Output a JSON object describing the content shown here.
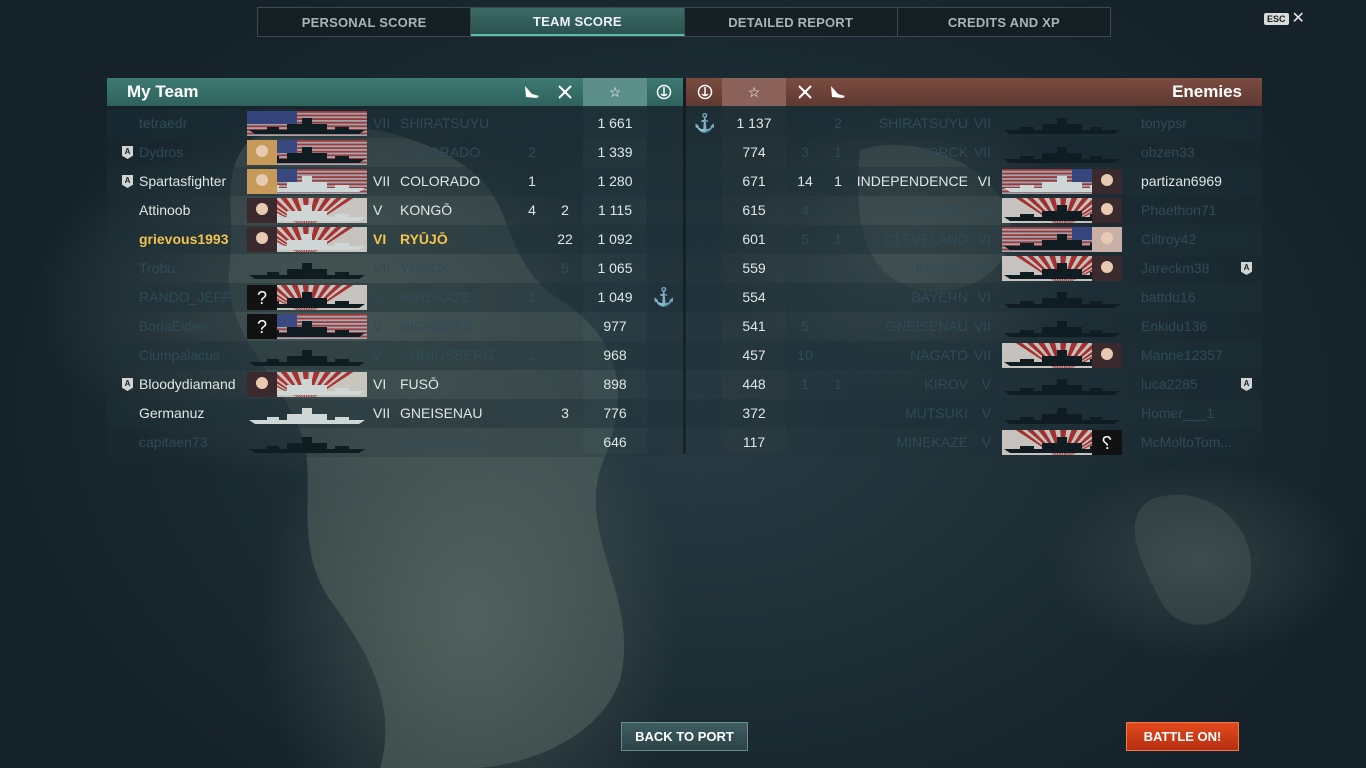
{
  "tabs": [
    {
      "label": "PERSONAL SCORE",
      "active": false
    },
    {
      "label": "TEAM SCORE",
      "active": true
    },
    {
      "label": "DETAILED REPORT",
      "active": false
    },
    {
      "label": "CREDITS AND XP",
      "active": false
    }
  ],
  "esc": {
    "key": "ESC",
    "close": "✕"
  },
  "my_team": {
    "title": "My Team",
    "header_icons": [
      "plane-kills-icon",
      "ship-kills-icon",
      "star-icon",
      "base-capture-icon"
    ],
    "rows": [
      {
        "badge": "",
        "player": "tetraedr",
        "portrait": "none",
        "flag": "us",
        "tier": "VII",
        "ship": "SHIRATSUYU",
        "planes": "",
        "kills": "",
        "score": "1 661",
        "capture": "",
        "alive": false
      },
      {
        "badge": "A",
        "player": "Dydros",
        "portrait": "blonde",
        "flag": "us",
        "tier": "VII",
        "ship": "COLORADO",
        "planes": "2",
        "kills": "",
        "score": "1 339",
        "capture": "",
        "alive": false
      },
      {
        "badge": "A",
        "player": "Spartasfighter",
        "portrait": "blonde",
        "flag": "us",
        "tier": "VII",
        "ship": "COLORADO",
        "planes": "1",
        "kills": "",
        "score": "1 280",
        "capture": "",
        "alive": true
      },
      {
        "badge": "",
        "player": "Attinoob",
        "portrait": "dark",
        "flag": "jp",
        "tier": "V",
        "ship": "KONGŌ",
        "planes": "4",
        "kills": "2",
        "score": "1 115",
        "capture": "",
        "alive": true
      },
      {
        "badge": "",
        "player": "grievous1993",
        "portrait": "dark",
        "flag": "jp",
        "tier": "VI",
        "ship": "RYŪJŌ",
        "planes": "",
        "kills": "22",
        "score": "1 092",
        "capture": "",
        "alive": true,
        "self": true
      },
      {
        "badge": "",
        "player": "Trobu",
        "portrait": "none",
        "flag": "none",
        "tier": "VII",
        "ship": "YORCK",
        "planes": "",
        "kills": "5",
        "score": "1 065",
        "capture": "",
        "alive": false
      },
      {
        "badge": "",
        "player": "RANDO_JEFF",
        "portrait": "unknown",
        "flag": "jp",
        "tier": "V",
        "ship": "MINEKAZE",
        "planes": "1",
        "kills": "",
        "score": "1 049",
        "capture": "⚓",
        "alive": false
      },
      {
        "badge": "",
        "player": "BoriaEiden",
        "portrait": "unknown",
        "flag": "us",
        "tier": "V",
        "ship": "NICHOLAS",
        "planes": "1",
        "kills": "",
        "score": "977",
        "capture": "",
        "alive": false
      },
      {
        "badge": "",
        "player": "Ciumpalacus",
        "portrait": "none",
        "flag": "none",
        "tier": "V",
        "ship": "KÖNIGSBERG",
        "planes": "1",
        "kills": "",
        "score": "968",
        "capture": "",
        "alive": false
      },
      {
        "badge": "A",
        "player": "Bloodydiamand",
        "portrait": "dark",
        "flag": "jp",
        "tier": "VI",
        "ship": "FUSŌ",
        "planes": "",
        "kills": "",
        "score": "898",
        "capture": "",
        "alive": true
      },
      {
        "badge": "",
        "player": "Germanuz",
        "portrait": "none",
        "flag": "none",
        "tier": "VII",
        "ship": "GNEISENAU",
        "planes": "",
        "kills": "3",
        "score": "776",
        "capture": "",
        "alive": true
      },
      {
        "badge": "",
        "player": "capitaen73",
        "portrait": "none",
        "flag": "none",
        "tier": "VI",
        "ship": "HATSUHARU",
        "planes": "",
        "kills": "",
        "score": "646",
        "capture": "",
        "alive": false
      }
    ]
  },
  "enemies": {
    "title": "Enemies",
    "header_icons": [
      "base-capture-icon",
      "star-icon",
      "ship-kills-icon",
      "plane-kills-icon"
    ],
    "rows": [
      {
        "capture": "⚓",
        "score": "1 137",
        "kills": "",
        "planes": "2",
        "ship": "SHIRATSUYU",
        "tier": "VII",
        "portrait": "none",
        "flag": "none",
        "player": "tonypsr",
        "badge": "",
        "alive": false
      },
      {
        "capture": "",
        "score": "774",
        "kills": "3",
        "planes": "1",
        "ship": "YORCK",
        "tier": "VII",
        "portrait": "none",
        "flag": "none",
        "player": "obzen33",
        "badge": "",
        "alive": false
      },
      {
        "capture": "",
        "score": "671",
        "kills": "14",
        "planes": "1",
        "ship": "INDEPENDENCE",
        "tier": "VI",
        "portrait": "dark",
        "flag": "us",
        "player": "partizan6969",
        "badge": "",
        "alive": true
      },
      {
        "capture": "",
        "score": "615",
        "kills": "4",
        "planes": "",
        "ship": "NAGATO",
        "tier": "VII",
        "portrait": "dark",
        "flag": "jp",
        "player": "Phaethon71",
        "badge": "",
        "alive": false
      },
      {
        "capture": "",
        "score": "601",
        "kills": "5",
        "planes": "1",
        "ship": "CLEVELAND",
        "tier": "VI",
        "portrait": "pale",
        "flag": "us",
        "player": "Ciltroy42",
        "badge": "",
        "alive": false
      },
      {
        "capture": "",
        "score": "559",
        "kills": "",
        "planes": "",
        "ship": "KONGŌ",
        "tier": "V",
        "portrait": "dark",
        "flag": "jp",
        "player": "Jareckm38",
        "badge": "A",
        "alive": false
      },
      {
        "capture": "",
        "score": "554",
        "kills": "",
        "planes": "",
        "ship": "BAYERN",
        "tier": "VI",
        "portrait": "none",
        "flag": "none",
        "player": "battdu16",
        "badge": "",
        "alive": false
      },
      {
        "capture": "",
        "score": "541",
        "kills": "5",
        "planes": "",
        "ship": "GNEISENAU",
        "tier": "VII",
        "portrait": "none",
        "flag": "none",
        "player": "Enkidu136",
        "badge": "",
        "alive": false
      },
      {
        "capture": "",
        "score": "457",
        "kills": "10",
        "planes": "",
        "ship": "NAGATO",
        "tier": "VII",
        "portrait": "dark",
        "flag": "jp",
        "player": "Manne12357",
        "badge": "",
        "alive": false
      },
      {
        "capture": "",
        "score": "448",
        "kills": "1",
        "planes": "1",
        "ship": "KIROV",
        "tier": "V",
        "portrait": "none",
        "flag": "none",
        "player": "luca2285",
        "badge": "A",
        "alive": false
      },
      {
        "capture": "",
        "score": "372",
        "kills": "",
        "planes": "",
        "ship": "MUTSUKI",
        "tier": "V",
        "portrait": "none",
        "flag": "none",
        "player": "Homer___1",
        "badge": "",
        "alive": false
      },
      {
        "capture": "",
        "score": "117",
        "kills": "",
        "planes": "",
        "ship": "MINEKAZE",
        "tier": "V",
        "portrait": "unknown",
        "flag": "jp",
        "player": "McMoltoTom...",
        "badge": "",
        "alive": false
      }
    ]
  },
  "buttons": {
    "back_to_port": "BACK TO PORT",
    "battle_on": "BATTLE ON!"
  },
  "colors": {
    "my_team_header": "#3d7a72",
    "enemy_header": "#7b4c40",
    "self_name": "#f2c44e",
    "battle_button": "#e24a1e"
  }
}
